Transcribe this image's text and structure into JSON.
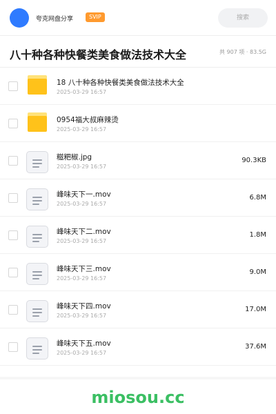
{
  "header": {
    "share_name": "夸克网盘分享",
    "badge": "SVIP",
    "search_placeholder": "搜索"
  },
  "folder": {
    "title": "八十种各种快餐类美食做法技术大全",
    "summary": "共 907 项 · 83.5G"
  },
  "items": [
    {
      "type": "folder",
      "name": "18 八十种各种快餐类美食做法技术大全",
      "date": "2025-03-29 16:57",
      "size": ""
    },
    {
      "type": "folder",
      "name": "0954福大叔麻辣烫",
      "date": "2025-03-29 16:57",
      "size": ""
    },
    {
      "type": "file",
      "name": "糍粑椒.jpg",
      "date": "2025-03-29 16:57",
      "size": "90.3KB"
    },
    {
      "type": "file",
      "name": "峰味天下一.mov",
      "date": "2025-03-29 16:57",
      "size": "6.8M"
    },
    {
      "type": "file",
      "name": "峰味天下二.mov",
      "date": "2025-03-29 16:57",
      "size": "1.8M"
    },
    {
      "type": "file",
      "name": "峰味天下三.mov",
      "date": "2025-03-29 16:57",
      "size": "9.0M"
    },
    {
      "type": "file",
      "name": "峰味天下四.mov",
      "date": "2025-03-29 16:57",
      "size": "17.0M"
    },
    {
      "type": "file",
      "name": "峰味天下五.mov",
      "date": "2025-03-29 16:57",
      "size": "37.6M"
    }
  ],
  "watermark": "miosou.cc",
  "colors": {
    "accent": "#2f7bff",
    "badge": "#ff9a2e",
    "folder": "#ffc21a",
    "watermark": "#3bbf63"
  }
}
